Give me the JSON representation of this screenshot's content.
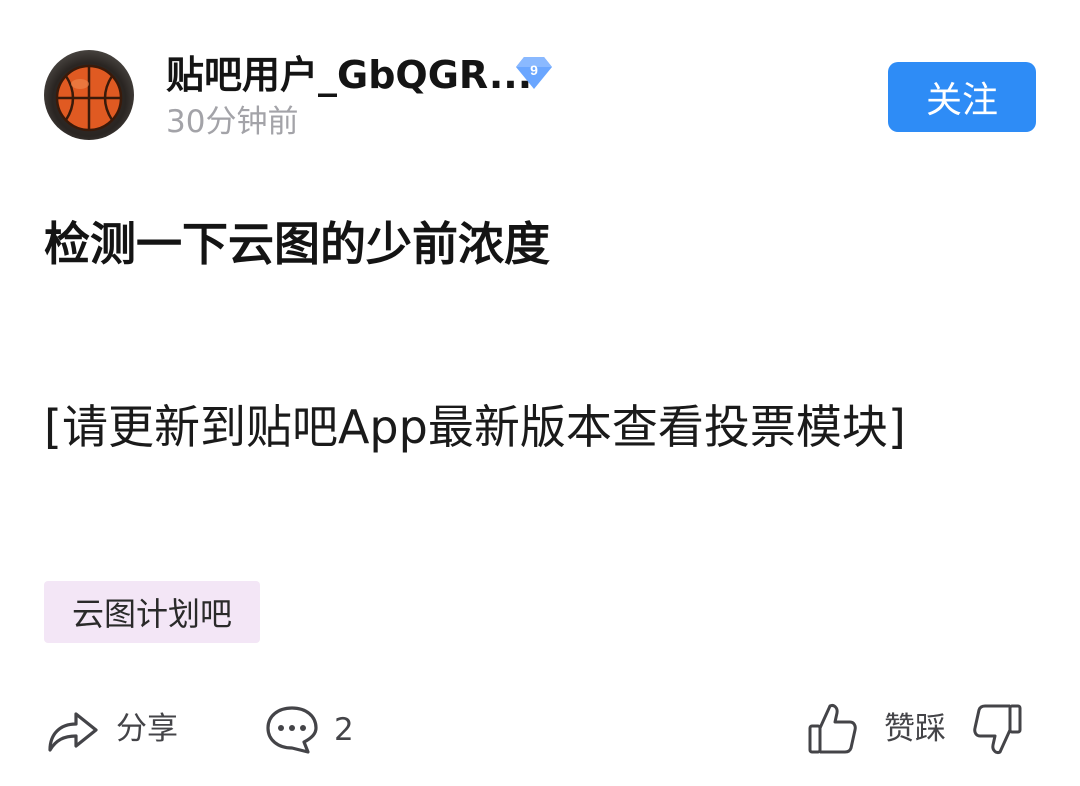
{
  "post": {
    "author": {
      "name": "贴吧用户_GbQGR...",
      "level": "9",
      "time": "30分钟前",
      "follow_label": "关注"
    },
    "title": "检测一下云图的少前浓度",
    "body": "[请更新到贴吧App最新版本查看投票模块]",
    "forum_tag": "云图计划吧"
  },
  "actions": {
    "share_label": "分享",
    "comment_count": "2",
    "like_dislike_label": "赞踩"
  },
  "colors": {
    "accent": "#2e8cf6",
    "tag_bg": "#f3e6f6",
    "muted_text": "#a3a3a8"
  },
  "icons": {
    "share": "share-arrow-icon",
    "comment": "comment-bubble-icon",
    "like": "thumbs-up-icon",
    "dislike": "thumbs-down-icon",
    "level": "diamond-level-icon",
    "avatar": "basketball-avatar"
  }
}
